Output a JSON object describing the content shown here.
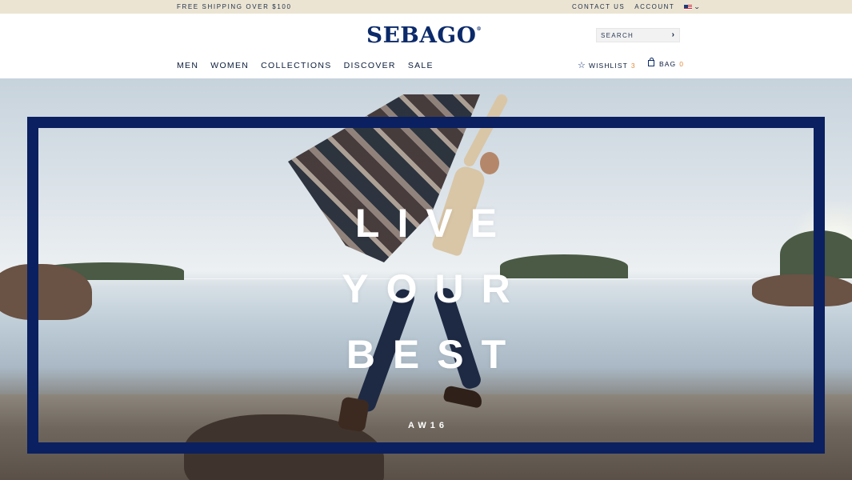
{
  "topbar": {
    "shipping": "FREE SHIPPING OVER $100",
    "contact": "CONTACT US",
    "account": "ACCOUNT"
  },
  "header": {
    "logo": "SEBAGO",
    "logo_mark": "®",
    "search_placeholder": "SEARCH",
    "nav": [
      "MEN",
      "WOMEN",
      "COLLECTIONS",
      "DISCOVER",
      "SALE"
    ],
    "wishlist_label": "WISHLIST",
    "wishlist_count": "3",
    "bag_label": "BAG",
    "bag_count": "0"
  },
  "hero": {
    "headline": [
      "LIVE",
      "YOUR",
      "BEST"
    ],
    "season": "AW16",
    "frame_color": "#0b2060"
  },
  "colors": {
    "brand_navy": "#0b2a6a",
    "topbar_bg": "#ebe4d2",
    "count_accent": "#e08a3c"
  },
  "icons": [
    "us-flag-icon",
    "chevron-down-icon",
    "search-arrow-icon",
    "star-icon",
    "bag-icon"
  ]
}
